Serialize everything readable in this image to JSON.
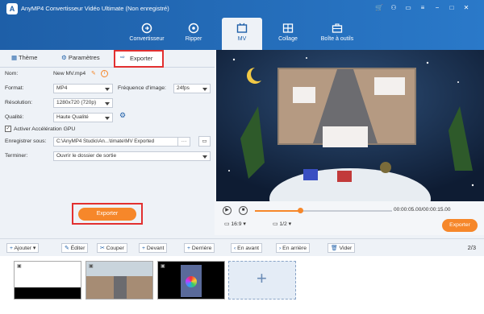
{
  "app": {
    "title": "AnyMP4 Convertisseur Vidéo Ultimate (Non enregistré)"
  },
  "nav": [
    {
      "label": "Convertisseur"
    },
    {
      "label": "Ripper"
    },
    {
      "label": "MV"
    },
    {
      "label": "Collage"
    },
    {
      "label": "Boîte à outils"
    }
  ],
  "subtabs": {
    "theme": "Thème",
    "params": "Paramètres",
    "export": "Exporter"
  },
  "form": {
    "name_label": "Nom:",
    "name_value": "New MV.mp4",
    "format_label": "Format:",
    "format_value": "MP4",
    "fps_label": "Fréquence d'image:",
    "fps_value": "24fps",
    "res_label": "Résolution:",
    "res_value": "1280x720 (720p)",
    "quality_label": "Qualité:",
    "quality_value": "Haute Qualité",
    "gpu_label": "Activer Accélération GPU",
    "save_label": "Enregistrer sous:",
    "save_value": "C:\\AnyMP4 Studio\\An...\\timate\\MV Exported",
    "save_more": "···",
    "end_label": "Terminer:",
    "end_value": "Ouvrir le dossier de sortie"
  },
  "export_button": "Exporter",
  "player": {
    "time": "00:00:05.00/00:00:15.00",
    "ratio": "16:9",
    "page": "1/2",
    "export": "Exporter",
    "progress": 0.33
  },
  "toolbar": {
    "add": "Ajouter",
    "edit": "Éditer",
    "cut": "Couper",
    "front": "Devant",
    "back": "Derrière",
    "forward": "En avant",
    "backward": "En arrière",
    "clear": "Vider",
    "count": "2/3"
  },
  "colors": {
    "brand": "#1e5fa8",
    "accent": "#f6872a",
    "highlight": "#e23030"
  }
}
